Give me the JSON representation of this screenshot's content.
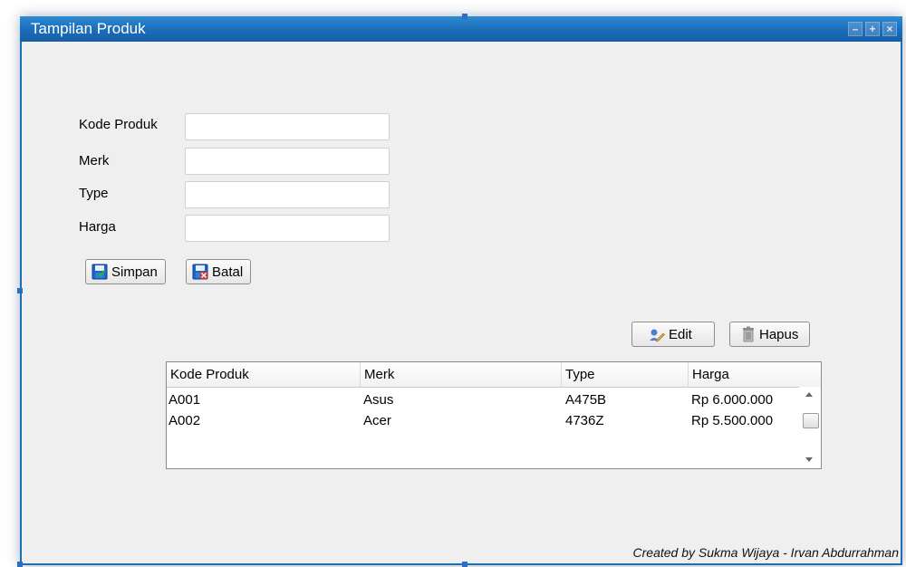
{
  "window": {
    "title": "Tampilan Produk",
    "controls": [
      "minimize-icon",
      "maximize-icon",
      "close-icon"
    ]
  },
  "form": {
    "fields": [
      {
        "label": "Kode Produk",
        "value": "",
        "placeholder": ""
      },
      {
        "label": "Merk",
        "value": "",
        "placeholder": ""
      },
      {
        "label": "Type",
        "value": "",
        "placeholder": ""
      },
      {
        "label": "Harga",
        "value": "",
        "placeholder": ""
      }
    ],
    "simpan_label": "Simpan",
    "batal_label": "Batal"
  },
  "table_actions": {
    "edit_label": "Edit",
    "hapus_label": "Hapus"
  },
  "table": {
    "columns": [
      "Kode Produk",
      "Merk",
      "Type",
      "Harga"
    ],
    "rows": [
      [
        "A001",
        "Asus",
        "A475B",
        "Rp 6.000.000"
      ],
      [
        "A002",
        "Acer",
        "4736Z",
        "Rp 5.500.000"
      ]
    ]
  },
  "footer": {
    "credit": "Created by Sukma Wijaya - Irvan Abdurrahman"
  },
  "colors": {
    "titlebar": "#1d70bd",
    "window_bg": "#efefef"
  }
}
